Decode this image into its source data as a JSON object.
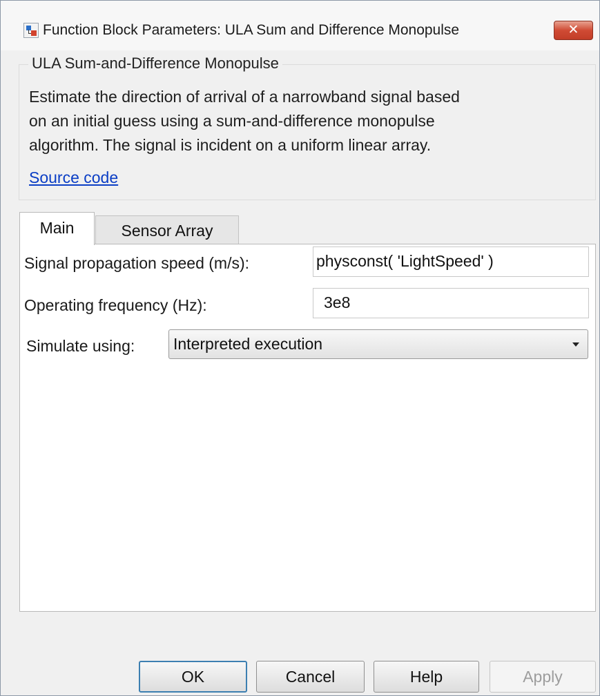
{
  "window": {
    "title": "Function Block Parameters: ULA Sum and Difference Monopulse",
    "close_label": "✕"
  },
  "description": {
    "group_title": "ULA Sum-and-Difference Monopulse",
    "lines": [
      "Estimate the direction of arrival of a narrowband signal based",
      "on an initial guess using a sum-and-difference monopulse",
      "algorithm. The signal is incident on a uniform linear array."
    ],
    "link": "Source code"
  },
  "tabs": [
    {
      "label": "Main",
      "active": true
    },
    {
      "label": "Sensor Array",
      "active": false
    }
  ],
  "parameters": {
    "speed": {
      "label": "Signal propagation speed (m/s):",
      "value": "physconst( 'LightSpeed' )"
    },
    "frequency": {
      "label": "Operating frequency (Hz):",
      "value": "3e8"
    },
    "simulate": {
      "label": "Simulate using:",
      "value": "Interpreted execution"
    }
  },
  "buttons": {
    "ok": "OK",
    "cancel": "Cancel",
    "help": "Help",
    "apply": "Apply"
  },
  "icons": {
    "window_icon": "simulink-block-icon",
    "close": "close-icon",
    "dropdown": "chevron-down-icon"
  }
}
